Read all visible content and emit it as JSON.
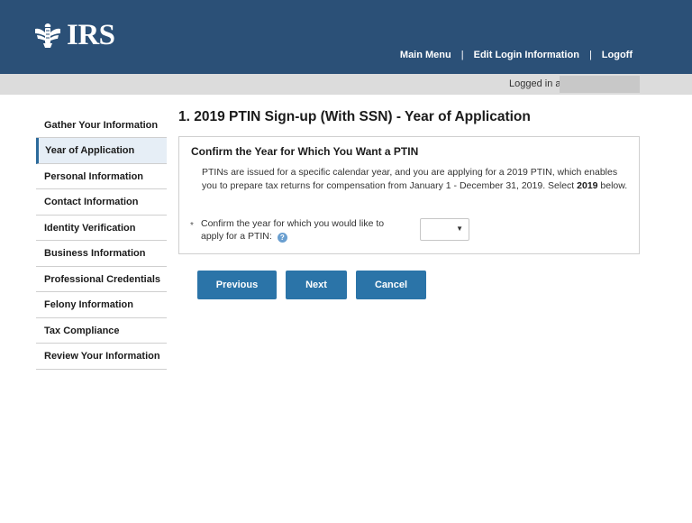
{
  "header": {
    "logo_text": "IRS",
    "nav": [
      "Main Menu",
      "Edit Login Information",
      "Logoff"
    ],
    "separator": "|"
  },
  "subbar": {
    "logged_in_label": "Logged in as"
  },
  "sidebar": {
    "items": [
      {
        "label": "Gather Your Information"
      },
      {
        "label": "Year of Application",
        "active": true
      },
      {
        "label": "Personal Information"
      },
      {
        "label": "Contact Information"
      },
      {
        "label": "Identity Verification"
      },
      {
        "label": "Business Information"
      },
      {
        "label": "Professional Credentials"
      },
      {
        "label": "Felony Information"
      },
      {
        "label": "Tax Compliance"
      },
      {
        "label": "Review Your Information"
      }
    ]
  },
  "main": {
    "page_title": "1. 2019 PTIN Sign-up (With SSN) - Year of Application",
    "panel": {
      "title": "Confirm the Year for Which You Want a PTIN",
      "desc_before": "PTINs are issued for a specific calendar year, and you are applying for a 2019 PTIN, which enables you to prepare tax returns for compensation from January 1 - December 31, 2019. Select ",
      "desc_bold": "2019",
      "desc_after": " below.",
      "required_marker": "*",
      "field_label": "Confirm the year for which you would like to apply for a PTIN:",
      "help_icon": "?",
      "select_value": "",
      "select_caret": "▼"
    },
    "buttons": {
      "previous": "Previous",
      "next": "Next",
      "cancel": "Cancel"
    }
  },
  "icons": {
    "logo": "irs-eagle-icon",
    "help": "help-circle-icon",
    "dropdown": "chevron-down-icon"
  },
  "colors": {
    "header_bg": "#2b5077",
    "button_bg": "#2b74a8",
    "active_item_bg": "#e6eef6"
  }
}
